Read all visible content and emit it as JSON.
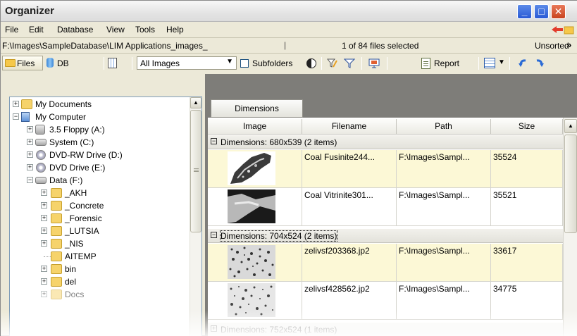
{
  "window": {
    "title": "Organizer"
  },
  "menu": {
    "items": [
      "File",
      "Edit",
      "Database",
      "View",
      "Tools",
      "Help"
    ]
  },
  "pathbar": {
    "path": "F:\\Images\\SampleDatabase\\LIM Applications_images_",
    "selection": "1 of 84 files selected",
    "sort": "Unsorted",
    "more": "»"
  },
  "toolbar": {
    "files_label": "Files",
    "db_label": "DB",
    "filter_value": "All Images",
    "subfolders_label": "Subfolders",
    "report_label": "Report"
  },
  "tree": {
    "items": [
      {
        "label": "My Documents",
        "icon": "folder-icon"
      },
      {
        "label": "My Computer",
        "icon": "computer-icon"
      },
      {
        "label": "3.5 Floppy (A:)",
        "icon": "floppy-icon"
      },
      {
        "label": "System (C:)",
        "icon": "hard-drive-icon"
      },
      {
        "label": "DVD-RW Drive (D:)",
        "icon": "dvd-icon"
      },
      {
        "label": "DVD Drive (E:)",
        "icon": "dvd-icon"
      },
      {
        "label": "Data (F:)",
        "icon": "hard-drive-icon"
      },
      {
        "label": "_AKH",
        "icon": "folder-icon"
      },
      {
        "label": "_Concrete",
        "icon": "folder-icon"
      },
      {
        "label": "_Forensic",
        "icon": "folder-icon"
      },
      {
        "label": "_LUTSIA",
        "icon": "folder-icon"
      },
      {
        "label": "_NIS",
        "icon": "folder-icon"
      },
      {
        "label": "AITEMP",
        "icon": "folder-icon"
      },
      {
        "label": "bin",
        "icon": "folder-icon"
      },
      {
        "label": "del",
        "icon": "folder-icon"
      },
      {
        "label": "Docs",
        "icon": "folder-icon"
      }
    ]
  },
  "grid": {
    "group_by_button": "Dimensions",
    "columns": [
      "Image",
      "Filename",
      "Path",
      "Size"
    ],
    "groups": [
      {
        "label": "Dimensions: 680x539 (2 items)",
        "toggle": "−",
        "rows": [
          {
            "filename": "Coal Fusinite244...",
            "path": "F:\\Images\\Sampl...",
            "size": "35524"
          },
          {
            "filename": "Coal Vitrinite301...",
            "path": "F:\\Images\\Sampl...",
            "size": "35521"
          }
        ]
      },
      {
        "label": "Dimensions: 704x524 (2 items)",
        "toggle": "−",
        "rows": [
          {
            "filename": "zelivsf203368.jp2",
            "path": "F:\\Images\\Sampl...",
            "size": "33617"
          },
          {
            "filename": "zelivsf428562.jp2",
            "path": "F:\\Images\\Sampl...",
            "size": "34775"
          }
        ]
      },
      {
        "label": "Dimensions: 752x524 (1 items)",
        "toggle": "+",
        "rows": []
      }
    ]
  },
  "colors": {
    "selected_row": "#fcf8d6",
    "pane_bg": "#7e7d79",
    "chrome": "#ece9d8"
  }
}
